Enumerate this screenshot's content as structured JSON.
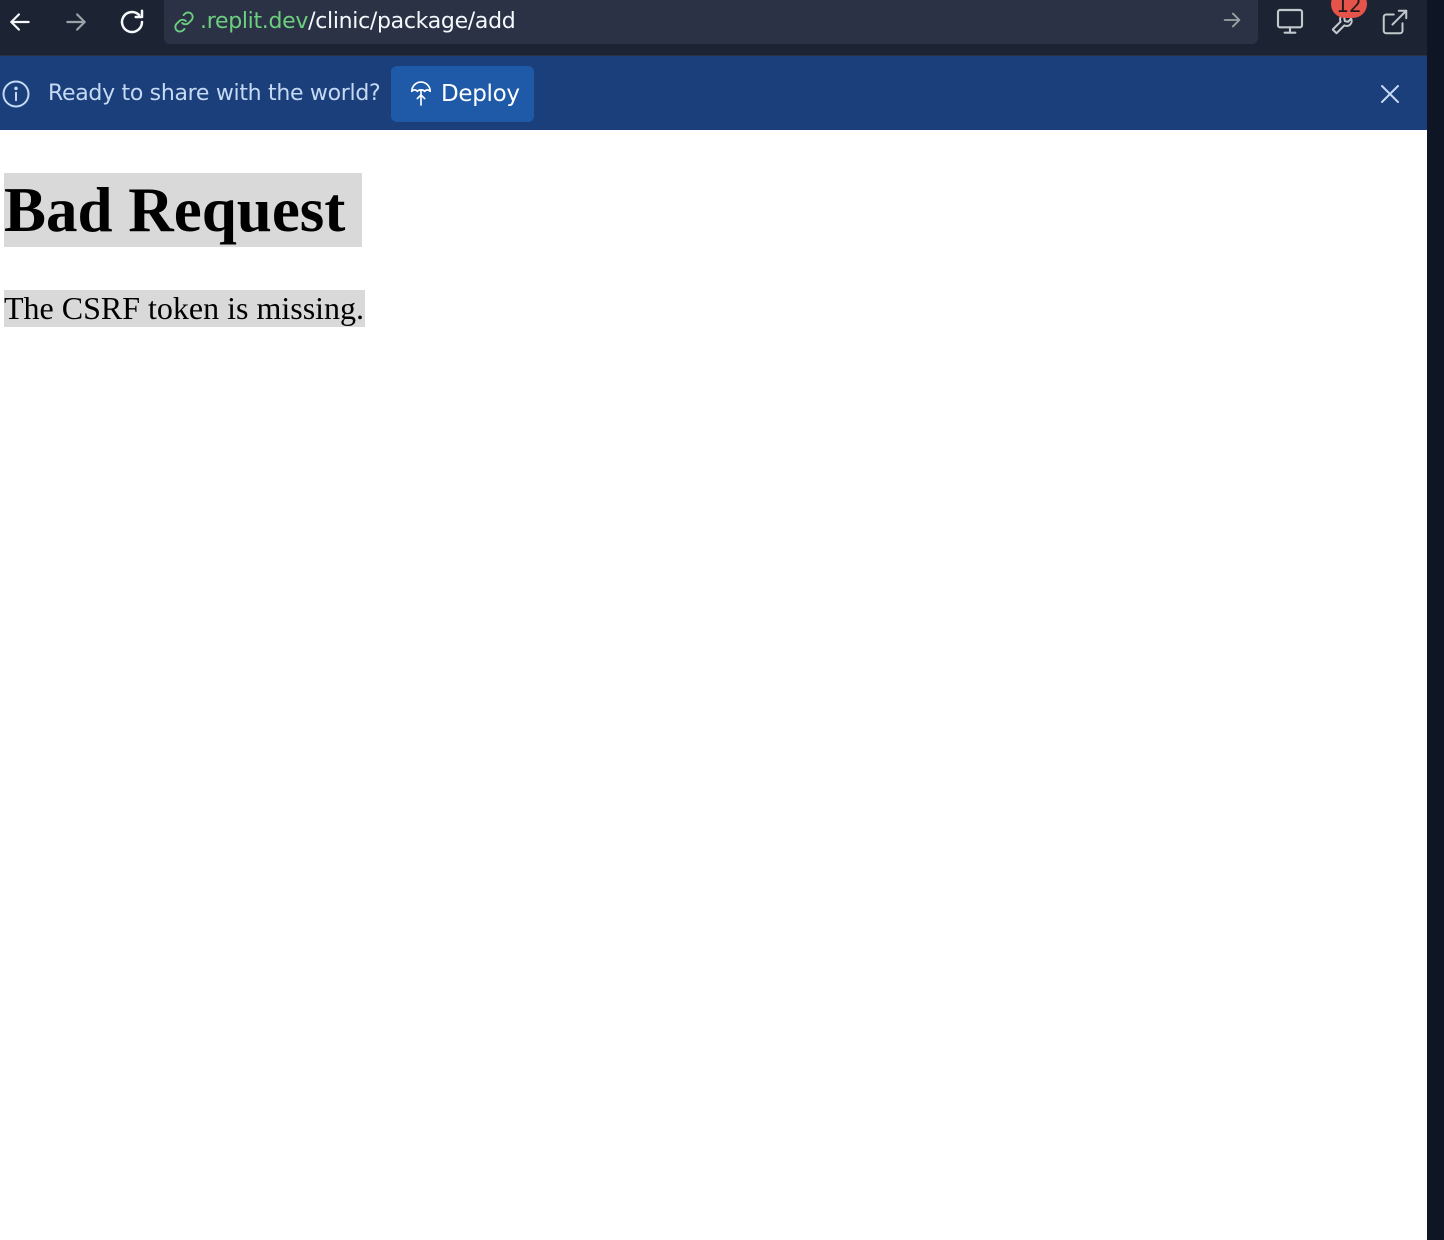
{
  "browser": {
    "url_host": ".replit.dev",
    "url_path": "/clinic/package/add",
    "tools_badge_count": "12",
    "icons": {
      "back": "arrow-left-icon",
      "forward": "arrow-right-icon",
      "reload": "reload-icon",
      "link": "link-icon",
      "go": "arrow-right-icon",
      "devices": "monitor-icon",
      "tools": "wrench-icon",
      "open_new_tab": "external-link-icon"
    }
  },
  "banner": {
    "message": "Ready to share with the world?",
    "deploy_label": "Deploy",
    "icons": {
      "info": "info-icon",
      "deploy": "parachute-icon",
      "close": "close-icon"
    },
    "colors": {
      "background": "#1a3f7a",
      "button": "#1f5aa9"
    }
  },
  "page": {
    "title": "Bad Request",
    "message": "The CSRF token is missing."
  },
  "colors": {
    "url_host": "#6ccf7f",
    "badge": "#e5534b",
    "highlight": "#d9d9d9"
  }
}
